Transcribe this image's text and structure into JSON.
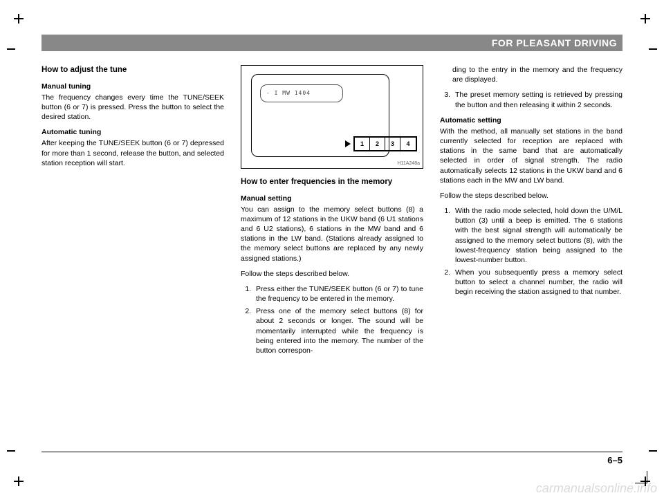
{
  "header": {
    "title": "FOR PLEASANT DRIVING"
  },
  "figure": {
    "displayText": "- I  MW  1404",
    "buttons": [
      "1",
      "2",
      "3",
      "4"
    ],
    "label": "H11A248a"
  },
  "col1": {
    "h3": "How to adjust the tune",
    "h4a": "Manual tuning",
    "pa": "The frequency changes every time the TUNE/SEEK button (6 or 7) is pressed. Press the button to select the desired station.",
    "h4b": "Automatic tuning",
    "pb": "After keeping the TUNE/SEEK button (6 or 7) depressed for more than 1 second, release the button, and selected station reception will start."
  },
  "col2": {
    "h3": "How to enter frequencies in the memory",
    "h4a": "Manual setting",
    "pa": "You can assign to the memory select buttons (8) a maximum of 12 stations in the UKW band (6 U1 stations and 6 U2 stations), 6 stations in the MW band and 6 stations in the LW band. (Stations already assigned to the memory select buttons are replaced by any newly assigned stations.)",
    "pb": "Follow the steps described below.",
    "ol": [
      "Press either the TUNE/SEEK button (6 or 7) to tune the frequency to be entered in the memory.",
      "Press one of the memory select buttons (8) for about 2 seconds or longer. The sound will be momentarily interrupted while the frequency is being entered into the memory. The number of the button correspon-"
    ]
  },
  "col3": {
    "pcont": "ding to the entry in the memory and the frequency are displayed.",
    "li3": "The preset memory setting is retrieved by pressing the button and then releasing it within 2 seconds.",
    "h4a": "Automatic setting",
    "pa": "With the method, all manually set stations in the band currently selected for reception are replaced with stations in the same band that are automatically selected in order of signal strength. The radio automatically selects 12 stations in the UKW band and 6 stations each in the MW and LW band.",
    "pb": "Follow the steps described below.",
    "ol": [
      "With the radio mode selected, hold down the U/M/L button (3) until a beep is emitted. The 6 stations with the best signal strength will automatically be assigned to the memory select buttons (8), with the lowest-frequency station being assigned to the lowest-number button.",
      "When you subsequently press a memory select button to select a channel number, the radio will begin receiving the station assigned to that number."
    ]
  },
  "footer": {
    "pageNum": "6–5"
  },
  "watermark": "carmanualsonline.info"
}
